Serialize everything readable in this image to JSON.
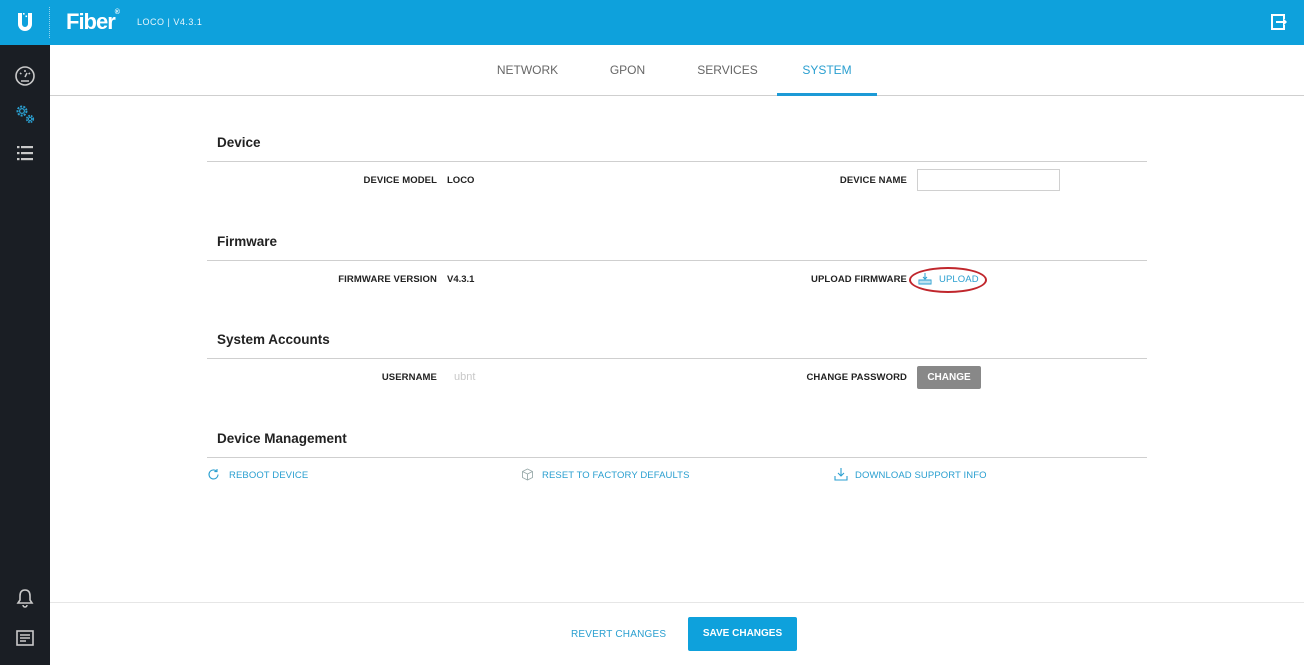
{
  "header": {
    "brand": "Fiber",
    "subtitle": "LOCO | V4.3.1",
    "logo_icon": "ubiquiti-u-logo",
    "logout_icon": "logout-icon"
  },
  "sidebar": {
    "items": [
      {
        "name": "dashboard",
        "icon": "dashboard-icon",
        "active": false
      },
      {
        "name": "settings",
        "icon": "gears-icon",
        "active": true
      },
      {
        "name": "list",
        "icon": "list-icon",
        "active": false
      }
    ],
    "bottom_items": [
      {
        "name": "notifications",
        "icon": "bell-icon"
      },
      {
        "name": "logs",
        "icon": "log-icon"
      }
    ]
  },
  "tabs": [
    {
      "label": "NETWORK",
      "active": false
    },
    {
      "label": "GPON",
      "active": false
    },
    {
      "label": "SERVICES",
      "active": false
    },
    {
      "label": "SYSTEM",
      "active": true
    }
  ],
  "sections": {
    "device": {
      "title": "Device",
      "device_model_label": "DEVICE MODEL",
      "device_model_value": "LOCO",
      "device_name_label": "DEVICE NAME",
      "device_name_value": ""
    },
    "firmware": {
      "title": "Firmware",
      "version_label": "FIRMWARE VERSION",
      "version_value": "V4.3.1",
      "upload_label": "UPLOAD FIRMWARE",
      "upload_link": "UPLOAD"
    },
    "accounts": {
      "title": "System Accounts",
      "username_label": "USERNAME",
      "username_value": "ubnt",
      "change_password_label": "CHANGE PASSWORD",
      "change_button": "CHANGE"
    },
    "management": {
      "title": "Device Management",
      "reboot": "REBOOT DEVICE",
      "reset": "RESET TO FACTORY DEFAULTS",
      "download": "DOWNLOAD SUPPORT INFO"
    }
  },
  "footer": {
    "revert": "REVERT CHANGES",
    "save": "SAVE CHANGES"
  },
  "colors": {
    "accent": "#0ea1dc",
    "sidebar": "#1a1e24",
    "highlight": "#c0262c"
  }
}
